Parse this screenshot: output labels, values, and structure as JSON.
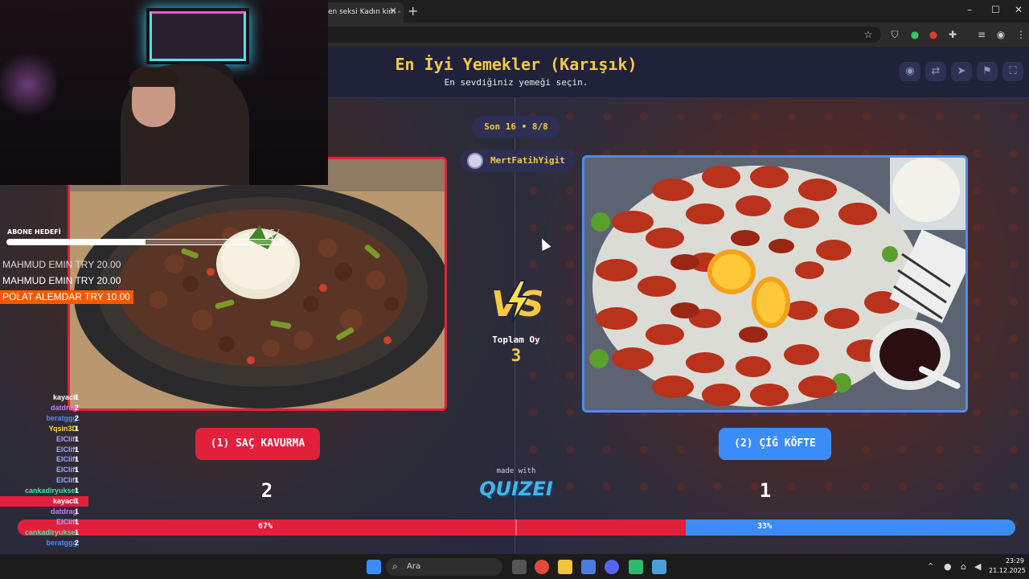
{
  "browser": {
    "tab_title": "en seksi Kadın kim -",
    "new_tab": "+",
    "window_controls": [
      "–",
      "☐",
      "✕"
    ]
  },
  "header": {
    "title": "En İyi Yemekler (Karışık)",
    "subtitle": "En sevdiğiniz yemeği seçin."
  },
  "round": "Son 16 • 8/8",
  "user": {
    "name": "MertFatihYigit"
  },
  "vs_label": "VS",
  "total": {
    "label": "Toplam Oy",
    "value": "3"
  },
  "left_choice": {
    "label": "(1) SAÇ KAVURMA",
    "count": "2",
    "percent_label": "67%",
    "percent": 0.67
  },
  "right_choice": {
    "label": "(2) ÇİĞ KÖFTE",
    "count": "1",
    "percent_label": "33%"
  },
  "made_with": "made with",
  "brand": "QUIZEI",
  "colors": {
    "accent": "#f6c945",
    "left": "#e41f3b",
    "right": "#3b8cf6",
    "page": "#1d1f36"
  },
  "stream": {
    "sub_goal": {
      "label": "ABONE HEDEFİ",
      "count": "5 / 10",
      "fraction": 0.5
    },
    "donations": [
      "MAHMUD EMIN  TRY 20.00",
      "MAHMUD EMIN  TRY 20.00",
      "POLAT ALEMDAR  TRY 10.00"
    ],
    "leaderboard": [
      {
        "name": "kayacil",
        "score": "1",
        "color": "#ffffff"
      },
      {
        "name": "datdrag",
        "score": "2",
        "color": "#c77dff"
      },
      {
        "name": "beratggg",
        "score": "2",
        "color": "#4d8cff"
      },
      {
        "name": "Yqsin3D",
        "score": "1",
        "color": "#ffd84d"
      },
      {
        "name": "ElCliff",
        "score": "1",
        "color": "#9ea9ff"
      },
      {
        "name": "ElCliff",
        "score": "1",
        "color": "#9ea9ff"
      },
      {
        "name": "ElCliff",
        "score": "1",
        "color": "#9ea9ff"
      },
      {
        "name": "ElCliff",
        "score": "1",
        "color": "#9ea9ff"
      },
      {
        "name": "ElCliff",
        "score": "1",
        "color": "#9ea9ff"
      },
      {
        "name": "cankadiryuksel",
        "score": "1",
        "color": "#3ee6a2"
      },
      {
        "name": "kayacil",
        "score": "1",
        "color": "#ffffff"
      },
      {
        "name": "datdrag",
        "score": "1",
        "color": "#c77dff"
      },
      {
        "name": "ElCliff",
        "score": "1",
        "color": "#9ea9ff"
      },
      {
        "name": "cankadiryuksel",
        "score": "1",
        "color": "#3ee6a2"
      },
      {
        "name": "beratggg",
        "score": "2",
        "color": "#4d8cff"
      }
    ]
  },
  "taskbar": {
    "search": "Ara",
    "time": "23:29",
    "date": "21.12.2025"
  }
}
